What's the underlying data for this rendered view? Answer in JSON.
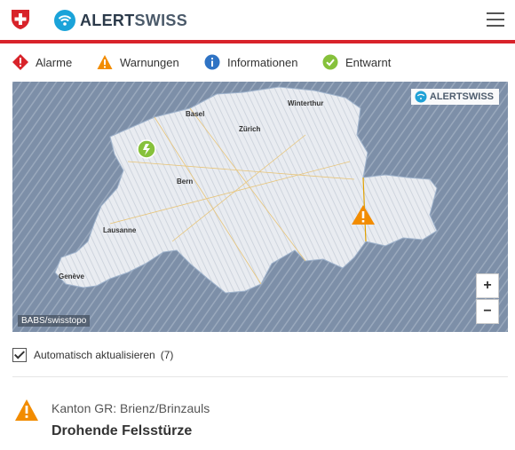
{
  "header": {
    "brand": {
      "part1": "ALERT",
      "part2": "SWISS"
    },
    "menu_icon": "hamburger-menu-icon",
    "accent_color": "#d8232a"
  },
  "legend": [
    {
      "label": "Alarme",
      "icon": "alarm-diamond-icon",
      "color": "#d8232a"
    },
    {
      "label": "Warnungen",
      "icon": "warning-triangle-icon",
      "color": "#f28c00"
    },
    {
      "label": "Informationen",
      "icon": "info-circle-icon",
      "color": "#2f73c4"
    },
    {
      "label": "Entwarnt",
      "icon": "all-clear-check-icon",
      "color": "#86c13b"
    }
  ],
  "map": {
    "badge": "ALERTSWISS",
    "credit": "BABS/swisstopo",
    "zoom_in": "+",
    "zoom_out": "−",
    "cities": [
      "Basel",
      "Winterthur",
      "Zürich",
      "Bern",
      "Lausanne",
      "Genève"
    ]
  },
  "auto_update": {
    "label": "Automatisch aktualisieren",
    "count": "(7)",
    "checked": true
  },
  "alert": {
    "region": "Kanton GR: Brienz/Brinzauls",
    "title": "Drohende Felsstürze",
    "level": "warning"
  }
}
